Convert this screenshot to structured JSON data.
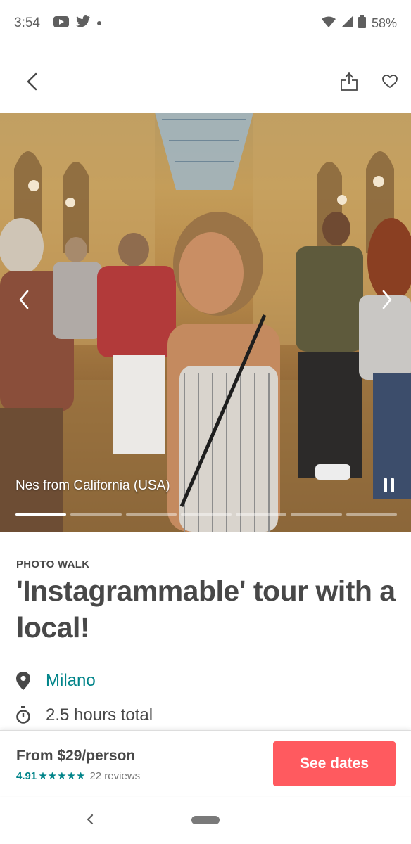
{
  "status_bar": {
    "time": "3:54",
    "battery": "58%",
    "icons": [
      "youtube-icon",
      "twitter-icon",
      "notification-dot",
      "wifi-icon",
      "signal-icon",
      "battery-icon"
    ]
  },
  "header": {
    "icons": [
      "back-arrow-icon",
      "share-icon",
      "heart-icon"
    ]
  },
  "hero": {
    "caption": "Nes from California (USA)",
    "slide_count": 7,
    "active_slide": 1
  },
  "experience": {
    "category": "PHOTO WALK",
    "title": "'Instagrammable' tour with a local!",
    "location": "Milano",
    "duration": "2.5 hours total"
  },
  "booking": {
    "price": "From $29/person",
    "rating": "4.91",
    "stars": "★★★★★",
    "reviews": "22 reviews",
    "cta_label": "See dates"
  },
  "colors": {
    "accent_teal": "#008489",
    "cta_red": "#ff5a5f",
    "text_dark": "#484848"
  }
}
